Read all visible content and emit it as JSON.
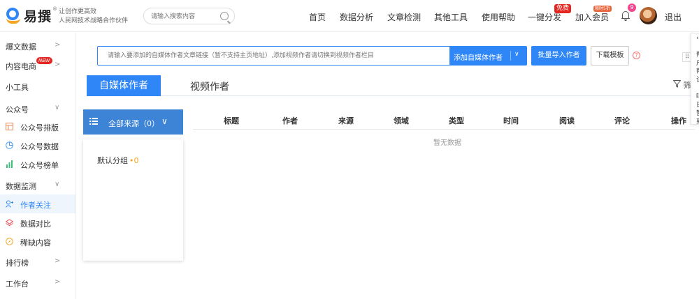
{
  "brand": {
    "name": "易撰",
    "registered": "®",
    "tagline_1": "让创作更高效",
    "tagline_2": "人民网技术战略合作伙伴"
  },
  "search": {
    "placeholder": "请输入搜索内容"
  },
  "nav": {
    "items": [
      "首页",
      "数据分析",
      "文章检测",
      "其他工具",
      "使用帮助",
      "一键分发",
      "加入会员"
    ],
    "free_badge": "免费",
    "member_badge": "限时5折",
    "notification_count": "9",
    "logout": "退出"
  },
  "sidebar": {
    "items": [
      {
        "label": "爆文数据",
        "arrow": ">"
      },
      {
        "label": "内容电商",
        "arrow": ">",
        "badge": "NEW"
      },
      {
        "label": "小工具"
      },
      {
        "label": "公众号",
        "arrow": "∨"
      },
      {
        "label": "公众号排版"
      },
      {
        "label": "公众号数据"
      },
      {
        "label": "公众号榜单"
      },
      {
        "label": "数据监测",
        "arrow": "∨"
      },
      {
        "label": "作者关注"
      },
      {
        "label": "数据对比"
      },
      {
        "label": "稀缺内容"
      },
      {
        "label": "排行榜",
        "arrow": ">"
      },
      {
        "label": "工作台",
        "arrow": ">"
      }
    ]
  },
  "author_input": {
    "placeholder": "请输入要添加的自媒体作者文章链接（暂不支持主页地址）,添加视频作者请切换到视频作者栏目"
  },
  "buttons": {
    "add_author": "添加自媒体作者",
    "add_chevron": "∨",
    "batch_import": "批量导入作者",
    "download_template": "下载模板",
    "help": "?"
  },
  "tabs": {
    "active": "自媒体作者",
    "other": "视频作者",
    "filter": "筛"
  },
  "source_filter": {
    "label": "全部来源（0）",
    "chevron": "∨"
  },
  "groups": [
    {
      "label": "默认分组",
      "count": "•0"
    }
  ],
  "table": {
    "columns": [
      "标题",
      "作者",
      "来源",
      "领域",
      "类型",
      "时间",
      "阅读",
      "评论",
      "操作"
    ],
    "empty_text": "暂无数据"
  },
  "edge_panel": {
    "chars": [
      "‹",
      "帮",
      "户",
      "帮",
      "试",
      "吗",
      "日",
      "暂",
      "到"
    ]
  },
  "colors": {
    "primary": "#2f86f6",
    "source_header": "#3d83d6",
    "badge_red": "#e5251f",
    "count_orange": "#f5a623"
  }
}
